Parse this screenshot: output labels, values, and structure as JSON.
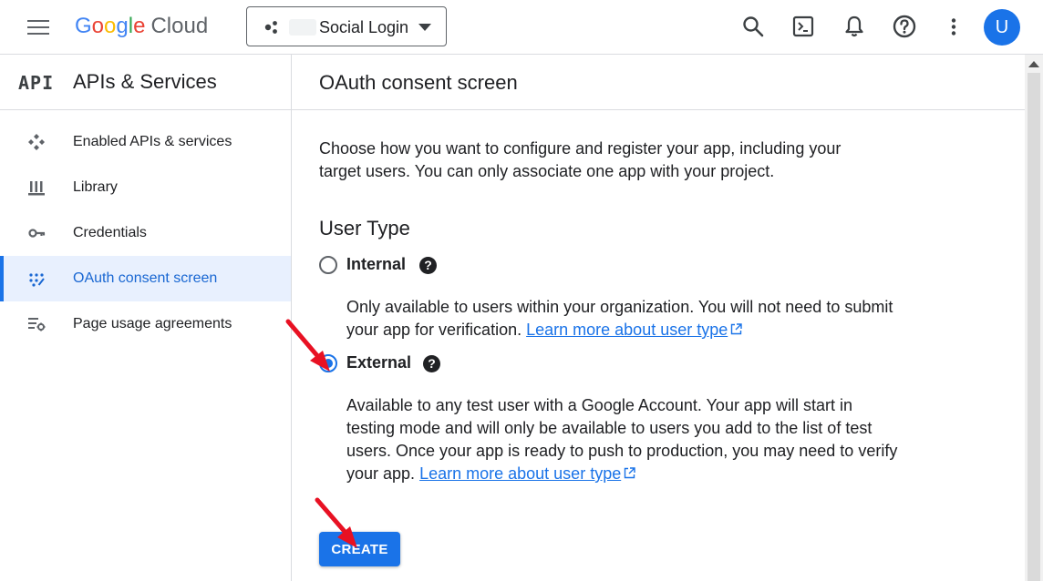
{
  "header": {
    "logo_letters": [
      "G",
      "o",
      "o",
      "g",
      "l",
      "e"
    ],
    "logo_product": "Cloud",
    "project_name": "Social Login",
    "avatar_letter": "U"
  },
  "sidebar": {
    "badge": "API",
    "title": "APIs & Services",
    "items": [
      {
        "label": "Enabled APIs & services",
        "icon": "apis-icon",
        "active": false
      },
      {
        "label": "Library",
        "icon": "library-icon",
        "active": false
      },
      {
        "label": "Credentials",
        "icon": "key-icon",
        "active": false
      },
      {
        "label": "OAuth consent screen",
        "icon": "consent-icon",
        "active": true
      },
      {
        "label": "Page usage agreements",
        "icon": "settings-list-icon",
        "active": false
      }
    ]
  },
  "main": {
    "title": "OAuth consent screen",
    "intro": "Choose how you want to configure and register your app, including your target users. You can only associate one app with your project.",
    "user_type_title": "User Type",
    "options": {
      "internal": {
        "label": "Internal",
        "checked": false,
        "desc": "Only available to users within your organization. You will not need to submit your app for verification.",
        "link": "Learn more about user type"
      },
      "external": {
        "label": "External",
        "checked": true,
        "desc": "Available to any test user with a Google Account. Your app will start in testing mode and will only be available to users you add to the list of test users. Once your app is ready to push to production, you may need to verify your app.",
        "link": "Learn more about user type"
      }
    },
    "create_label": "CREATE",
    "help_glyph": "?"
  },
  "colors": {
    "accent": "#1a73e8",
    "active_bg": "#e8f0fe",
    "annotation_arrow": "#e81123"
  }
}
